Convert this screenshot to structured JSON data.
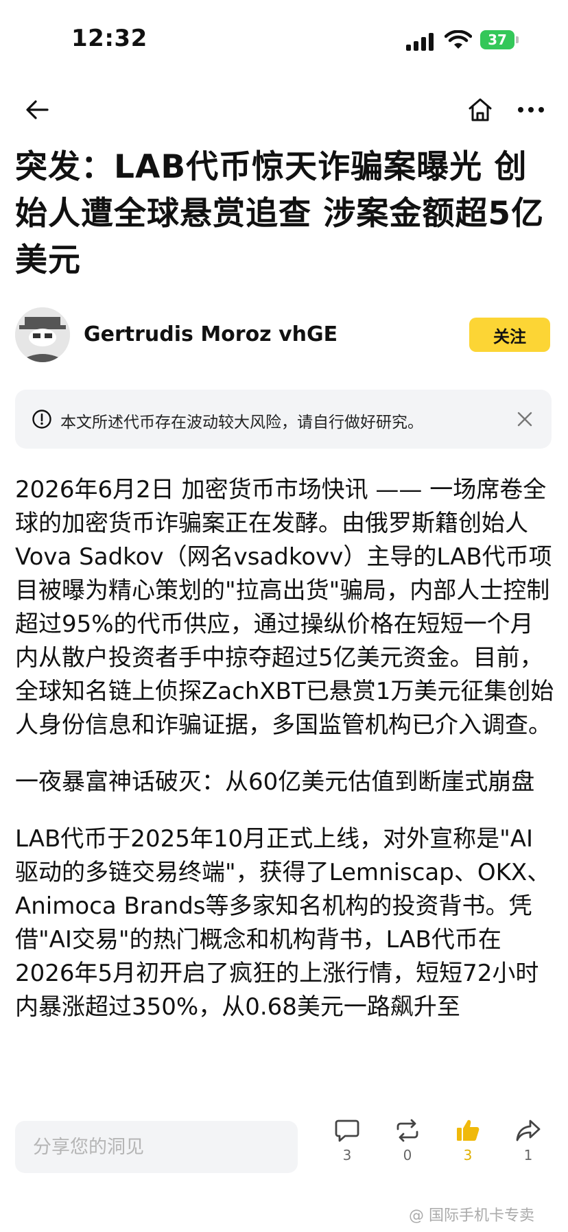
{
  "status_bar": {
    "time": "12:32",
    "battery": "37"
  },
  "article": {
    "title": "突发：LAB代币惊天诈骗案曝光 创始人遭全球悬赏追查 涉案金额超5亿美元",
    "author": "Gertrudis Moroz vhGE",
    "follow_label": "关注",
    "risk_notice": "本文所述代币存在波动较大风险，请自行做好研究。",
    "paragraphs": [
      "2026年6月2日 加密货币市场快讯 —— 一场席卷全球的加密货币诈骗案正在发酵。由俄罗斯籍创始人Vova Sadkov（网名vsadkovv）主导的LAB代币项目被曝为精心策划的\"拉高出货\"骗局，内部人士控制超过95%的代币供应，通过操纵价格在短短一个月内从散户投资者手中掠夺超过5亿美元资金。目前，全球知名链上侦探ZachXBT已悬赏1万美元征集创始人身份信息和诈骗证据，多国监管机构已介入调查。",
      "一夜暴富神话破灭：从60亿美元估值到断崖式崩盘",
      "LAB代币于2025年10月正式上线，对外宣称是\"AI驱动的多链交易终端\"，获得了Lemniscap、OKX、Animoca Brands等多家知名机构的投资背书。凭借\"AI交易\"的热门概念和机构背书，LAB代币在2026年5月初开启了疯狂的上涨行情，短短72小时内暴涨超过350%，从0.68美元一路飙升至"
    ]
  },
  "bottom_bar": {
    "comment_placeholder": "分享您的洞见",
    "comments_count": "3",
    "reposts_count": "0",
    "likes_count": "3",
    "shares_count": "1"
  },
  "watermark": "@ 国际手机卡专卖",
  "colors": {
    "accent": "#fcd535",
    "liked": "#f0b90b"
  }
}
